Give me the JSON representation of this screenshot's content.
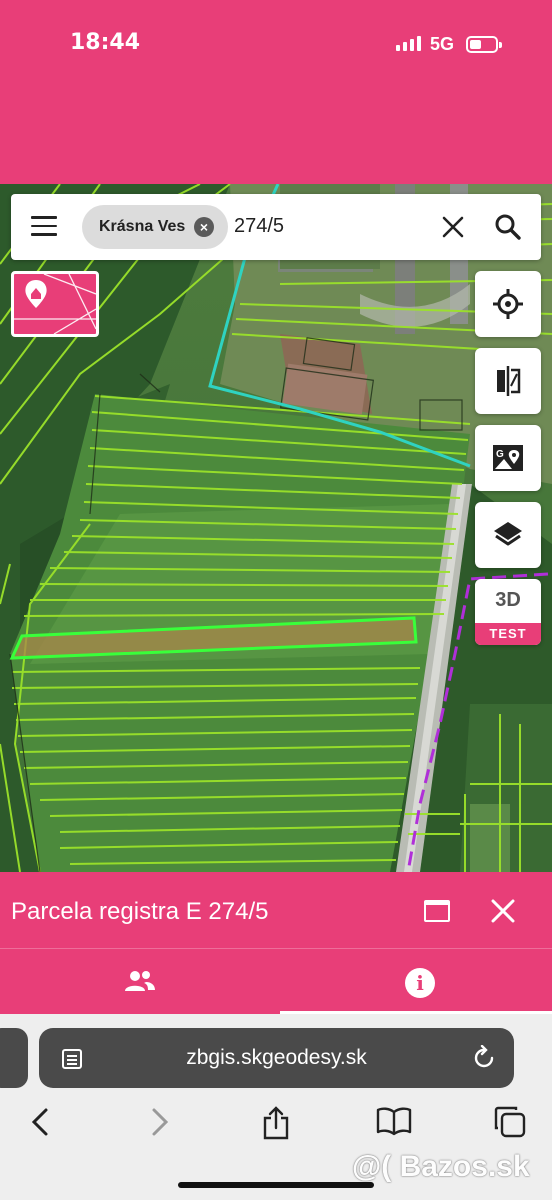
{
  "status_bar": {
    "time": "18:44",
    "network": "5G"
  },
  "search": {
    "location_chip": "Krásna Ves",
    "query": "274/5"
  },
  "map": {
    "tools": [
      "locate-icon",
      "compare-icon",
      "google-maps-icon",
      "layers-icon"
    ],
    "mode_3d": {
      "label": "3D",
      "badge": "TEST"
    }
  },
  "panel": {
    "title": "Parcela registra E 274/5",
    "tabs": [
      "owners-icon",
      "info-icon"
    ],
    "active_tab": 1
  },
  "browser": {
    "url": "zbgis.skgeodesy.sk"
  },
  "watermark": "@( Bazos.sk",
  "colors": {
    "brand": "#e83e78",
    "parcel_lines": "#9be22a",
    "selected_parcel": "#39ff3a",
    "boundary": "#2fd3c1",
    "territory": "#b02fd8"
  }
}
